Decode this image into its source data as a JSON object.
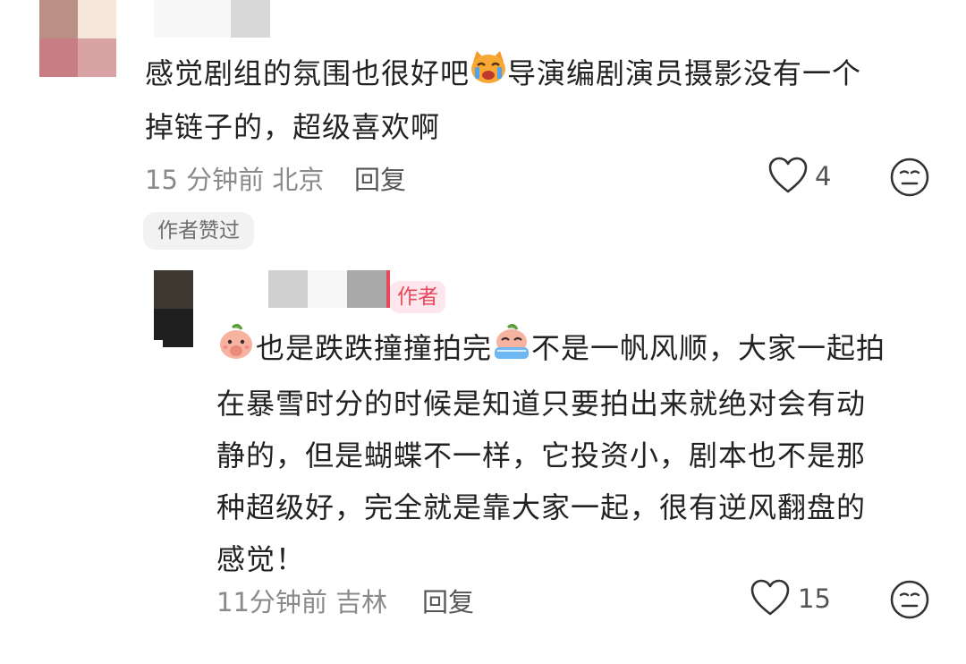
{
  "comment1": {
    "line1_a": "感觉剧组的氛围也很好吧",
    "line1_b": "导演编剧演员摄影没有一个",
    "line2": "掉链子的，超级喜欢啊",
    "time": "15 分钟前",
    "location": "北京",
    "reply_label": "回复",
    "likes": "4",
    "author_liked_badge": "作者赞过",
    "emoji": "cat-tears-icon"
  },
  "reply1": {
    "author_badge": "作者",
    "line1_a": "也是跌跌撞撞拍完",
    "line1_b": "不是一帆风顺，大家一起拍",
    "line2": "在暴雪时分的时候是知道只要拍出来就绝对会有动",
    "line3": "静的，但是蝴蝶不一样，它投资小，剧本也不是那",
    "line4": "种超级好，完全就是靠大家一起，很有逆风翻盘的",
    "line5": "感觉！",
    "time": "11分钟前",
    "location": "吉林",
    "reply_label": "回复",
    "likes": "15",
    "emoji1": "peach-shy-icon",
    "emoji2": "crying-face-icon"
  },
  "colors": {
    "author_badge_bg": "#fde7ec",
    "author_badge_text": "#e8485b",
    "meta_gray": "#8a8a8a"
  }
}
